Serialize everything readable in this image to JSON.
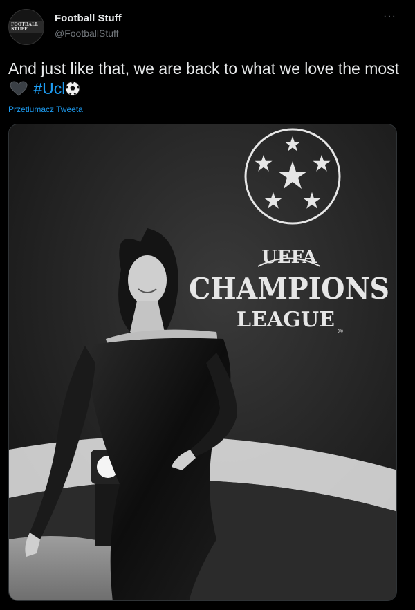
{
  "account": {
    "name": "Football Stuff",
    "handle": "@FootballStuff",
    "avatar_text": "FOOTBALL STUFF"
  },
  "more_label": "···",
  "tweet": {
    "text": "And just like that, we are back to what we love the most",
    "hashtag": "#Ucl"
  },
  "translate_label": "Przetłumacz Tweeta",
  "photo": {
    "logo_top": "UEFA",
    "logo_middle": "CHAMPIONS",
    "logo_bottom": "LEAGUE",
    "registered_mark": "®"
  },
  "colors": {
    "background": "#000000",
    "text": "#e7e9ea",
    "secondary_text": "#71767b",
    "link": "#1d9bf0"
  },
  "icons": {
    "heart": "black-heart-icon",
    "ball": "soccer-ball-icon",
    "more": "more-options-icon"
  }
}
